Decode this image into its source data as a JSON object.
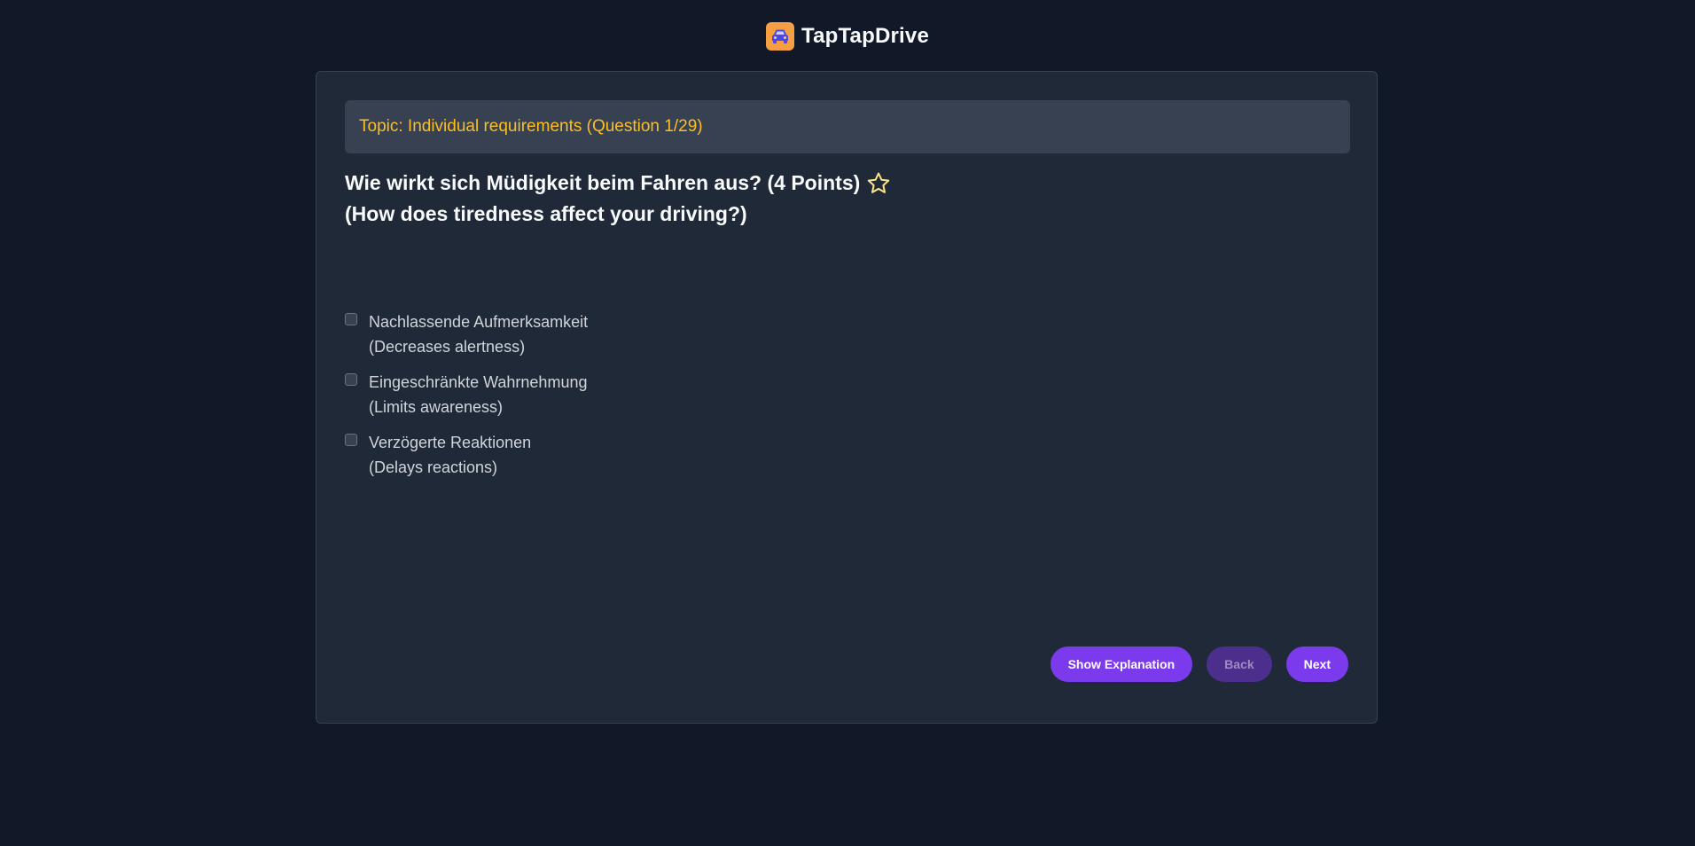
{
  "app": {
    "title": "TapTapDrive",
    "logo_icon": "car-icon",
    "logo_color": "#f59e42"
  },
  "topic": {
    "text": "Topic: Individual requirements (Question 1/29)",
    "color": "#fbbf24"
  },
  "question": {
    "german": "Wie wirkt sich Müdigkeit beim Fahren aus? (4 Points)",
    "english": "(How does tiredness affect your driving?)",
    "favorite_icon": "star-outline-icon"
  },
  "answers": [
    {
      "german": "Nachlassende Aufmerksamkeit",
      "english": "(Decreases alertness)",
      "checked": false
    },
    {
      "german": "Eingeschränkte Wahrnehmung",
      "english": "(Limits awareness)",
      "checked": false
    },
    {
      "german": "Verzögerte Reaktionen",
      "english": "(Delays reactions)",
      "checked": false
    }
  ],
  "buttons": {
    "explanation": "Show Explanation",
    "back": "Back",
    "next": "Next",
    "accent": "#7c3aed"
  }
}
